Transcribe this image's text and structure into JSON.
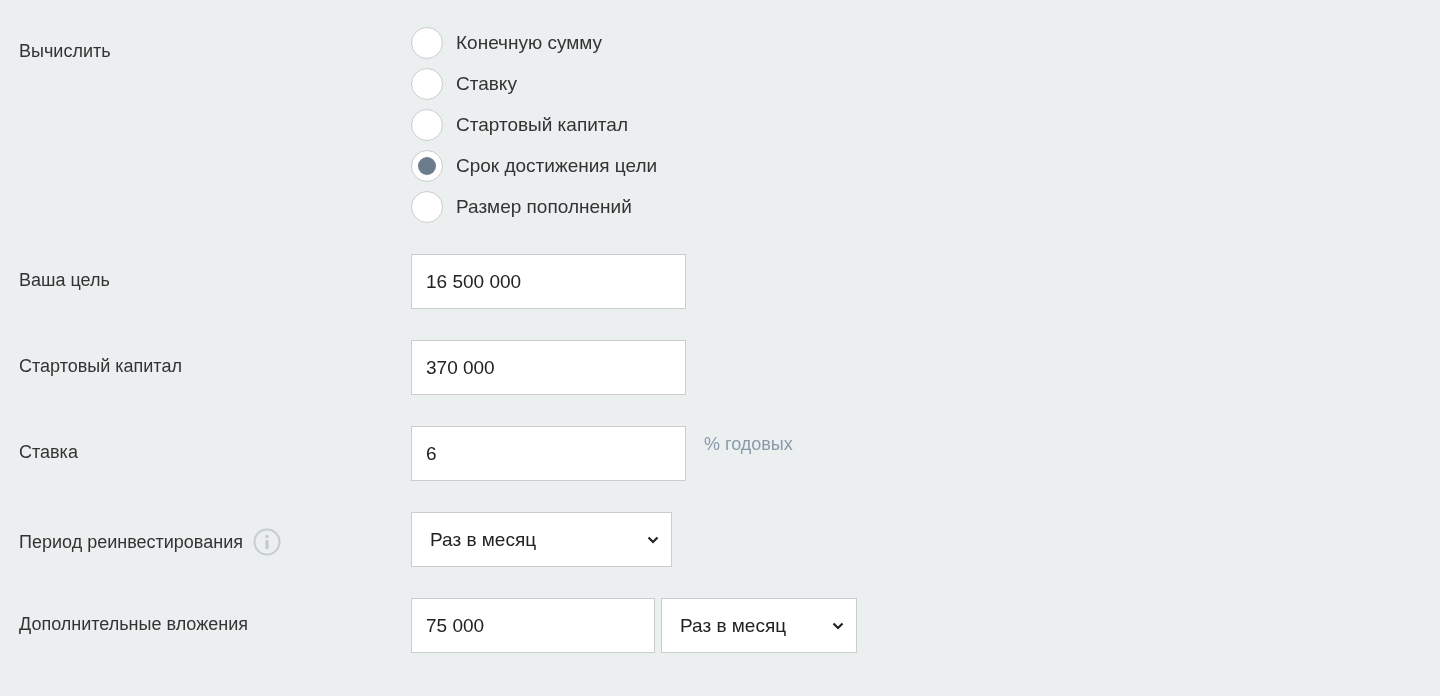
{
  "rows": [
    {
      "kind": "radio",
      "label": "Вычислить",
      "options": [
        {
          "label": "Конечную сумму",
          "selected": false
        },
        {
          "label": "Ставку",
          "selected": false
        },
        {
          "label": "Стартовый капитал",
          "selected": false
        },
        {
          "label": "Срок достижения цели",
          "selected": true
        },
        {
          "label": "Размер пополнений",
          "selected": false
        }
      ]
    },
    {
      "kind": "text",
      "label": "Ваша цель",
      "value": "16 500 000"
    },
    {
      "kind": "text",
      "label": "Стартовый капитал",
      "value": "370 000"
    },
    {
      "kind": "text",
      "label": "Ставка",
      "value": "6",
      "suffix": "% годовых"
    },
    {
      "kind": "select",
      "label": "Период реинвестирования",
      "info": true,
      "value": "Раз в месяц"
    },
    {
      "kind": "text_select",
      "label": "Дополнительные вложения",
      "value": "75 000",
      "select": "Раз в месяц"
    }
  ]
}
